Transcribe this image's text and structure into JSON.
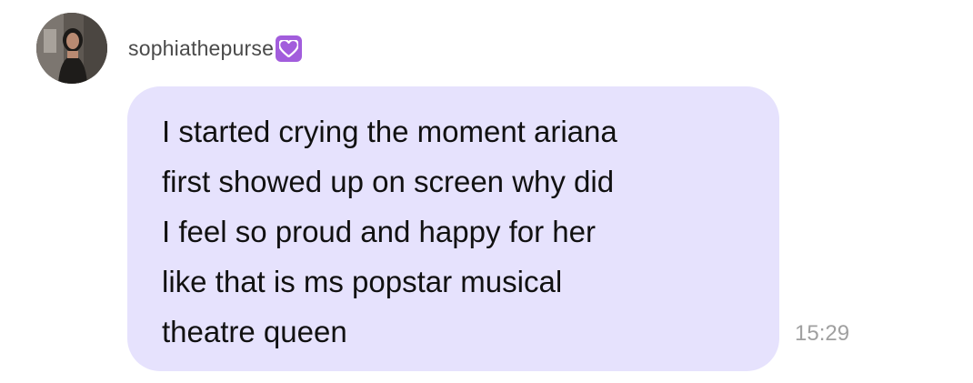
{
  "message": {
    "sender": {
      "username": "sophiathepurse",
      "avatar_icon": "profile-photo-avatar",
      "badge_icon": "purple-heart-icon",
      "badge_color": "#a25ddc"
    },
    "lines": [
      "I started crying the moment ariana",
      "first showed up on screen why did",
      "I feel so proud and happy for her",
      "like that is ms popstar musical",
      "theatre queen"
    ],
    "time": "15:29",
    "bubble_color": "#e6e2fd"
  }
}
